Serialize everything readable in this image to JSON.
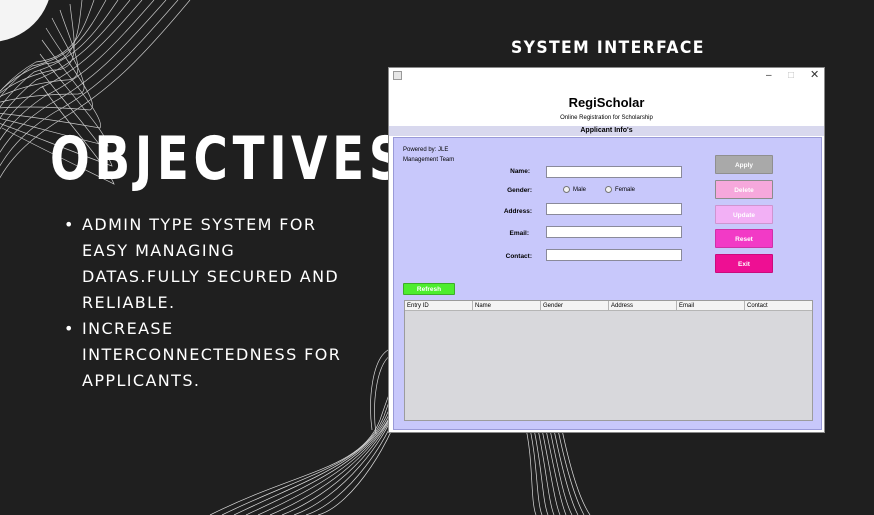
{
  "slide": {
    "title": "OBJECTIVES",
    "bullets": [
      "ADMIN TYPE SYSTEM FOR EASY MANAGING DATAS.FULLY SECURED AND RELIABLE.",
      "INCREASE INTERCONNECTEDNESS FOR APPLICANTS."
    ],
    "system_heading": "SYSTEM INTERFACE"
  },
  "window": {
    "controls": {
      "minimize": "–",
      "maximize": "□",
      "close": "✕"
    },
    "app_name": "RegiScholar",
    "app_subtitle": "Online Registration for Scholarship",
    "section_title": "Applicant Info's",
    "powered_by": "Powered by: JLE Management Team",
    "form": {
      "name_label": "Name:",
      "gender_label": "Gender:",
      "gender_options": [
        "Male",
        "Female"
      ],
      "address_label": "Address:",
      "email_label": "Email:",
      "contact_label": "Contact:",
      "name_value": "",
      "address_value": "",
      "email_value": "",
      "contact_value": ""
    },
    "buttons": {
      "apply": "Apply",
      "delete": "Delete",
      "update": "Update",
      "reset": "Reset",
      "exit": "Exit",
      "refresh": "Refresh"
    },
    "table": {
      "columns": [
        "Entry ID",
        "Name",
        "Gender",
        "Address",
        "Email",
        "Contact"
      ],
      "rows": []
    }
  },
  "colors": {
    "background": "#1f1f1f",
    "panel": "#c8c8fb",
    "apply": "#a9a9a9",
    "delete": "#f6a8dc",
    "update": "#f2b0f5",
    "reset": "#f23ac6",
    "exit": "#ee0f93",
    "refresh": "#4ded2e"
  }
}
